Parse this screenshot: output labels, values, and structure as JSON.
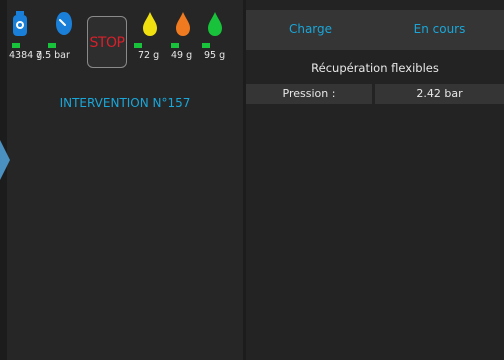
{
  "left": {
    "readings": [
      {
        "icon": "refrigerant-bottle-icon",
        "color": "#1a7fd8",
        "value": "4384 g"
      },
      {
        "icon": "pressure-gauge-icon",
        "color": "#1a7fd8",
        "value": "7.5 bar"
      },
      {
        "icon": "oil-drop-yellow-icon",
        "color": "#f0e010",
        "value": "72 g"
      },
      {
        "icon": "oil-drop-orange-icon",
        "color": "#f07a20",
        "value": "49 g"
      },
      {
        "icon": "oil-drop-green-icon",
        "color": "#18c23a",
        "value": "95 g"
      }
    ],
    "stop_label": "STOP",
    "intervention": "INTERVENTION N°157"
  },
  "right": {
    "header_left": "Charge",
    "header_right": "En cours",
    "subtitle": "Récupération flexibles",
    "row": {
      "label": "Pression :",
      "value": "2.42 bar"
    }
  },
  "colors": {
    "accent": "#1aa6d8",
    "ok_bar": "#18c23a",
    "stop": "#d8202a"
  }
}
